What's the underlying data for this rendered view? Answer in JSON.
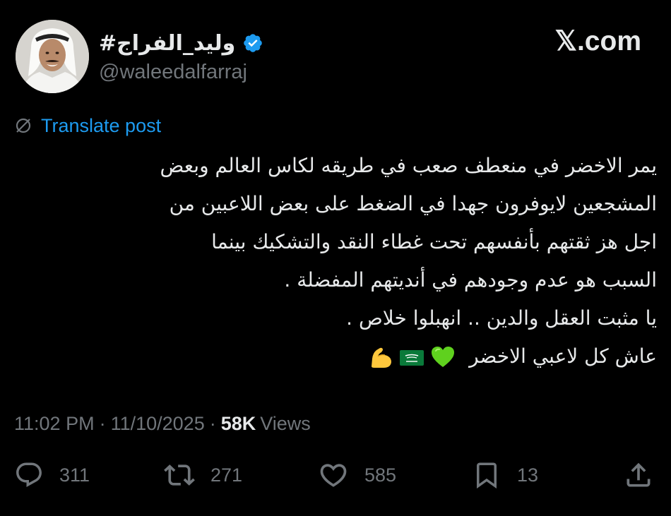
{
  "author": {
    "display_name": "#وليد_الفراج",
    "handle": "@waleedalfarraj",
    "verified": true,
    "avatar_icon": "avatar-photo"
  },
  "brand": "𝕏.com",
  "translate": {
    "icon": "translate-globe-icon",
    "label": "Translate post"
  },
  "post": {
    "lines": [
      "يمر الاخضر في منعطف صعب في طريقه لكاس العالم وبعض",
      "المشجعين لايوفرون جهدا في الضغط على بعض اللاعبين من",
      "اجل هز ثقتهم بأنفسهم تحت غطاء النقد والتشكيك بينما",
      "السبب هو عدم وجودهم في أنديتهم المفضلة .",
      "يا مثبت العقل والدين .. انهبلوا خلاص .",
      "عاش كل لاعبي الاخضر"
    ],
    "emojis": [
      "green-heart",
      "saudi-flag",
      "flexed-biceps"
    ]
  },
  "meta": {
    "time": "11:02 PM",
    "separator": "·",
    "date": "11/10/2025",
    "views_count": "58K",
    "views_label": "Views"
  },
  "actions": {
    "replies": "311",
    "reposts": "271",
    "likes": "585",
    "bookmarks": "13"
  },
  "colors": {
    "background": "#000000",
    "text": "#e7e9ea",
    "muted": "#71767b",
    "link": "#1d9bf0",
    "verified": "#1d9bf0"
  }
}
